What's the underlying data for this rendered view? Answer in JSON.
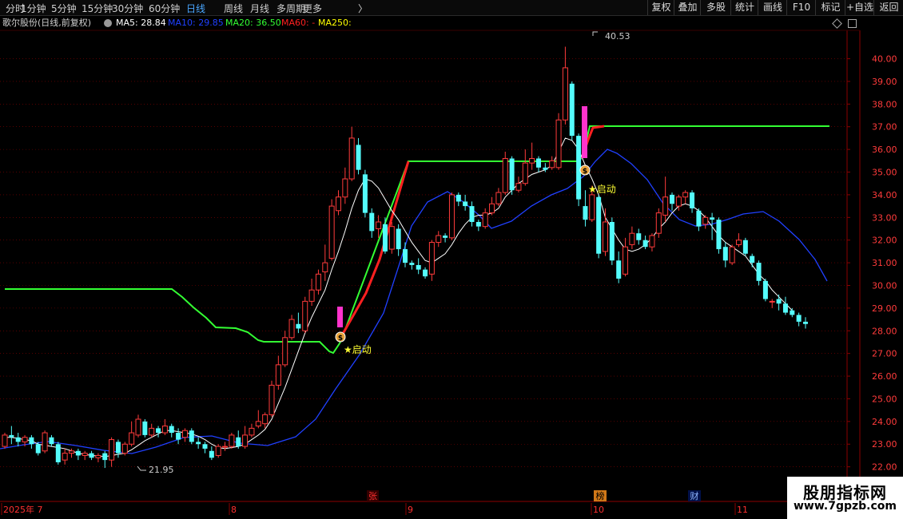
{
  "toolbar": {
    "periods": [
      "分时",
      "1分钟",
      "5分钟",
      "15分钟",
      "30分钟",
      "60分钟",
      "日线",
      "周线",
      "月线",
      "多周期",
      "更多"
    ],
    "more_chevron": "〉",
    "active_period": "日线",
    "right_buttons": [
      "复权",
      "叠加",
      "多股",
      "统计",
      "画线",
      "F10",
      "标记",
      "+自选",
      "返回"
    ]
  },
  "header": {
    "stock_name": "歌尔股份(日线,前复权)",
    "ma5": "MA5: 28.84",
    "ma10": "MA10: 29.85",
    "ma20": "MA20: 36.50",
    "ma60": "MA60: -",
    "ma250": "MA250:"
  },
  "colors": {
    "up": "#ff3b3b",
    "down": "#54fcfc",
    "ma5": "#ffffff",
    "ma10": "#2040ff",
    "ma20": "#33ff33",
    "ma60": "#ff2020",
    "ma250": "#ffff00",
    "signal_bar": "#ff33cc"
  },
  "signals": {
    "start_label": "★启动",
    "money_icon_glyph": "$"
  },
  "annotations": {
    "high_label": "40.53",
    "low_label": "21.95"
  },
  "markers": {
    "zhang": "张",
    "bang": "榜",
    "cai": "财"
  },
  "timeline": [
    "2025年 7",
    "8",
    "9",
    "10",
    "11"
  ],
  "watermark": {
    "title": "股朋指标网",
    "url": "www.7gpzb.com"
  },
  "chart_data": {
    "type": "candlestick",
    "ylim": [
      21.6,
      40.9
    ],
    "y_ticks": [
      "22.00",
      "23.00",
      "24.00",
      "25.00",
      "26.00",
      "27.00",
      "28.00",
      "29.00",
      "30.00",
      "31.00",
      "32.00",
      "33.00",
      "34.00",
      "35.00",
      "36.00",
      "37.00",
      "38.00",
      "39.00",
      "40.00"
    ],
    "candles": [
      [
        22.9,
        23.4,
        22.8,
        23.5
      ],
      [
        23.4,
        23.3,
        23.0,
        23.8
      ],
      [
        23.3,
        23.1,
        22.9,
        23.5
      ],
      [
        23.1,
        23.3,
        22.9,
        23.4
      ],
      [
        23.3,
        23.0,
        22.8,
        23.4
      ],
      [
        23.0,
        22.6,
        22.5,
        23.1
      ],
      [
        22.7,
        23.5,
        22.6,
        23.6
      ],
      [
        23.3,
        23.0,
        22.9,
        23.4
      ],
      [
        23.0,
        22.2,
        22.1,
        23.1
      ],
      [
        22.3,
        22.6,
        22.1,
        22.8
      ],
      [
        22.6,
        22.7,
        22.4,
        22.8
      ],
      [
        22.7,
        22.5,
        22.3,
        22.8
      ],
      [
        22.5,
        22.6,
        22.3,
        22.7
      ],
      [
        22.6,
        22.4,
        22.3,
        22.7
      ],
      [
        22.4,
        22.5,
        22.2,
        22.6
      ],
      [
        22.6,
        22.3,
        21.95,
        22.7
      ],
      [
        22.3,
        23.2,
        22.0,
        23.3
      ],
      [
        23.1,
        22.6,
        22.4,
        23.2
      ],
      [
        22.6,
        23.0,
        22.5,
        23.1
      ],
      [
        23.0,
        23.5,
        22.9,
        24.0
      ],
      [
        23.4,
        24.1,
        23.3,
        24.3
      ],
      [
        24.0,
        23.4,
        23.3,
        24.1
      ],
      [
        23.4,
        23.7,
        23.3,
        23.9
      ],
      [
        23.7,
        23.5,
        23.3,
        23.8
      ],
      [
        23.5,
        23.8,
        23.4,
        24.1
      ],
      [
        23.8,
        23.5,
        23.3,
        23.9
      ],
      [
        23.5,
        23.2,
        23.0,
        23.7
      ],
      [
        23.3,
        23.6,
        23.1,
        23.7
      ],
      [
        23.6,
        23.1,
        23.0,
        23.7
      ],
      [
        23.1,
        23.0,
        22.8,
        23.3
      ],
      [
        23.0,
        22.8,
        22.6,
        23.1
      ],
      [
        22.7,
        22.4,
        22.3,
        22.9
      ],
      [
        22.5,
        22.9,
        22.4,
        23.0
      ],
      [
        22.9,
        22.9,
        22.7,
        23.1
      ],
      [
        22.9,
        23.4,
        22.8,
        23.5
      ],
      [
        23.3,
        22.9,
        22.8,
        23.6
      ],
      [
        22.9,
        23.4,
        22.8,
        23.8
      ],
      [
        23.4,
        23.7,
        23.3,
        23.9
      ],
      [
        23.8,
        24.0,
        23.7,
        24.5
      ],
      [
        23.9,
        24.3,
        23.7,
        24.4
      ],
      [
        24.3,
        25.6,
        24.2,
        25.8
      ],
      [
        25.6,
        26.5,
        25.4,
        26.9
      ],
      [
        26.5,
        27.7,
        26.4,
        28.0
      ],
      [
        27.7,
        28.5,
        27.6,
        28.7
      ],
      [
        28.3,
        28.1,
        27.9,
        28.8
      ],
      [
        28.0,
        29.3,
        27.9,
        29.5
      ],
      [
        29.3,
        29.8,
        29.1,
        30.3
      ],
      [
        29.8,
        30.5,
        29.6,
        30.7
      ],
      [
        30.6,
        31.0,
        30.2,
        31.8
      ],
      [
        31.2,
        33.5,
        31.1,
        33.8
      ],
      [
        33.3,
        33.9,
        33.1,
        34.2
      ],
      [
        33.9,
        34.7,
        33.6,
        35.2
      ],
      [
        34.7,
        36.5,
        34.6,
        37.0
      ],
      [
        36.2,
        35.1,
        34.9,
        36.5
      ],
      [
        34.9,
        33.2,
        33.0,
        35.1
      ],
      [
        33.2,
        32.4,
        32.1,
        33.4
      ],
      [
        32.5,
        32.8,
        32.1,
        33.1
      ],
      [
        32.7,
        31.5,
        31.4,
        33.0
      ],
      [
        31.6,
        32.6,
        31.4,
        32.8
      ],
      [
        32.5,
        31.6,
        31.3,
        32.7
      ],
      [
        31.6,
        31.0,
        30.8,
        31.9
      ],
      [
        31.0,
        30.9,
        30.7,
        31.1
      ],
      [
        30.9,
        30.7,
        30.5,
        31.2
      ],
      [
        30.7,
        30.4,
        30.3,
        30.8
      ],
      [
        30.5,
        31.9,
        30.2,
        32.0
      ],
      [
        31.9,
        32.2,
        31.7,
        32.4
      ],
      [
        32.2,
        32.1,
        31.9,
        32.3
      ],
      [
        32.1,
        34.0,
        32.0,
        34.1
      ],
      [
        34.0,
        33.7,
        33.5,
        34.1
      ],
      [
        33.7,
        33.5,
        33.3,
        34.0
      ],
      [
        33.5,
        32.8,
        32.6,
        33.7
      ],
      [
        32.8,
        32.6,
        32.4,
        32.9
      ],
      [
        32.6,
        33.2,
        32.5,
        33.4
      ],
      [
        33.2,
        33.6,
        33.1,
        33.9
      ],
      [
        33.6,
        34.1,
        33.5,
        34.3
      ],
      [
        34.1,
        35.6,
        34.0,
        35.9
      ],
      [
        35.6,
        34.2,
        34.0,
        35.7
      ],
      [
        34.2,
        34.5,
        34.1,
        34.8
      ],
      [
        34.5,
        35.4,
        34.4,
        36.0
      ],
      [
        35.4,
        35.6,
        35.1,
        36.3
      ],
      [
        35.6,
        35.2,
        35.0,
        35.7
      ],
      [
        35.2,
        35.1,
        35.0,
        35.4
      ],
      [
        35.2,
        35.5,
        35.1,
        35.7
      ],
      [
        35.2,
        37.3,
        35.1,
        37.6
      ],
      [
        37.3,
        39.6,
        37.1,
        40.53
      ],
      [
        38.9,
        36.6,
        36.4,
        39.0
      ],
      [
        36.6,
        33.8,
        33.5,
        36.7
      ],
      [
        33.5,
        32.9,
        32.6,
        34.2
      ],
      [
        32.9,
        34.0,
        32.8,
        34.4
      ],
      [
        33.9,
        31.4,
        31.2,
        34.0
      ],
      [
        31.5,
        32.8,
        31.3,
        33.4
      ],
      [
        32.8,
        31.1,
        30.9,
        33.0
      ],
      [
        31.1,
        30.3,
        30.1,
        31.5
      ],
      [
        30.5,
        31.7,
        30.4,
        32.1
      ],
      [
        31.8,
        32.3,
        31.6,
        32.6
      ],
      [
        32.3,
        32.0,
        31.8,
        32.5
      ],
      [
        32.0,
        31.7,
        31.6,
        32.2
      ],
      [
        31.7,
        32.2,
        31.5,
        32.3
      ],
      [
        32.3,
        33.2,
        32.1,
        33.4
      ],
      [
        33.1,
        33.9,
        32.8,
        34.8
      ],
      [
        34.0,
        33.6,
        33.3,
        34.1
      ],
      [
        33.5,
        33.9,
        33.3,
        34.0
      ],
      [
        33.9,
        34.1,
        33.6,
        34.2
      ],
      [
        34.1,
        33.4,
        33.2,
        34.2
      ],
      [
        33.3,
        32.6,
        32.4,
        33.4
      ],
      [
        32.7,
        33.0,
        32.5,
        33.1
      ],
      [
        33.0,
        32.9,
        32.0,
        33.2
      ],
      [
        32.9,
        31.6,
        31.4,
        33.0
      ],
      [
        31.7,
        31.1,
        30.8,
        31.9
      ],
      [
        31.0,
        31.7,
        30.9,
        31.8
      ],
      [
        31.8,
        32.0,
        31.7,
        32.3
      ],
      [
        32.0,
        31.4,
        31.3,
        32.1
      ],
      [
        31.3,
        31.0,
        30.8,
        31.4
      ],
      [
        31.0,
        30.2,
        30.0,
        31.1
      ],
      [
        30.2,
        29.4,
        29.3,
        30.3
      ],
      [
        29.3,
        29.3,
        29.0,
        29.4
      ],
      [
        29.4,
        29.2,
        28.9,
        29.6
      ],
      [
        29.2,
        28.8,
        28.7,
        29.5
      ],
      [
        28.9,
        28.7,
        28.6,
        29.0
      ],
      [
        28.7,
        28.4,
        28.2,
        28.8
      ],
      [
        28.4,
        28.3,
        28.1,
        28.6
      ]
    ],
    "ma5": [
      23.3,
      23.3,
      23.25,
      23.2,
      23.15,
      23.0,
      22.95,
      22.9,
      22.85,
      22.8,
      22.7,
      22.6,
      22.55,
      22.5,
      22.48,
      22.45,
      22.5,
      22.55,
      22.6,
      22.75,
      22.95,
      23.15,
      23.3,
      23.45,
      23.6,
      23.6,
      23.55,
      23.5,
      23.45,
      23.35,
      23.2,
      23.0,
      22.85,
      22.8,
      22.85,
      22.9,
      23.0,
      23.2,
      23.4,
      23.65,
      24.1,
      24.8,
      25.5,
      26.3,
      27.1,
      27.9,
      28.6,
      29.2,
      29.8,
      30.7,
      31.5,
      32.4,
      33.4,
      34.2,
      34.7,
      34.6,
      34.3,
      33.8,
      33.3,
      32.9,
      32.4,
      31.9,
      31.5,
      31.1,
      31.0,
      31.2,
      31.4,
      31.8,
      32.3,
      32.7,
      33.0,
      33.1,
      33.1,
      33.2,
      33.4,
      33.9,
      34.2,
      34.5,
      34.7,
      34.9,
      35.0,
      35.1,
      35.3,
      35.9,
      36.5,
      36.4,
      36.0,
      35.3,
      34.7,
      34.0,
      33.0,
      32.5,
      32.0,
      31.6,
      31.5,
      31.6,
      31.8,
      32.1,
      32.5,
      32.8,
      33.2,
      33.5,
      33.6,
      33.5,
      33.3,
      33.0,
      32.6,
      32.2,
      31.9,
      31.7,
      31.5,
      31.3,
      30.9,
      30.5,
      30.2,
      29.8,
      29.5,
      29.2,
      28.9
    ]
  }
}
